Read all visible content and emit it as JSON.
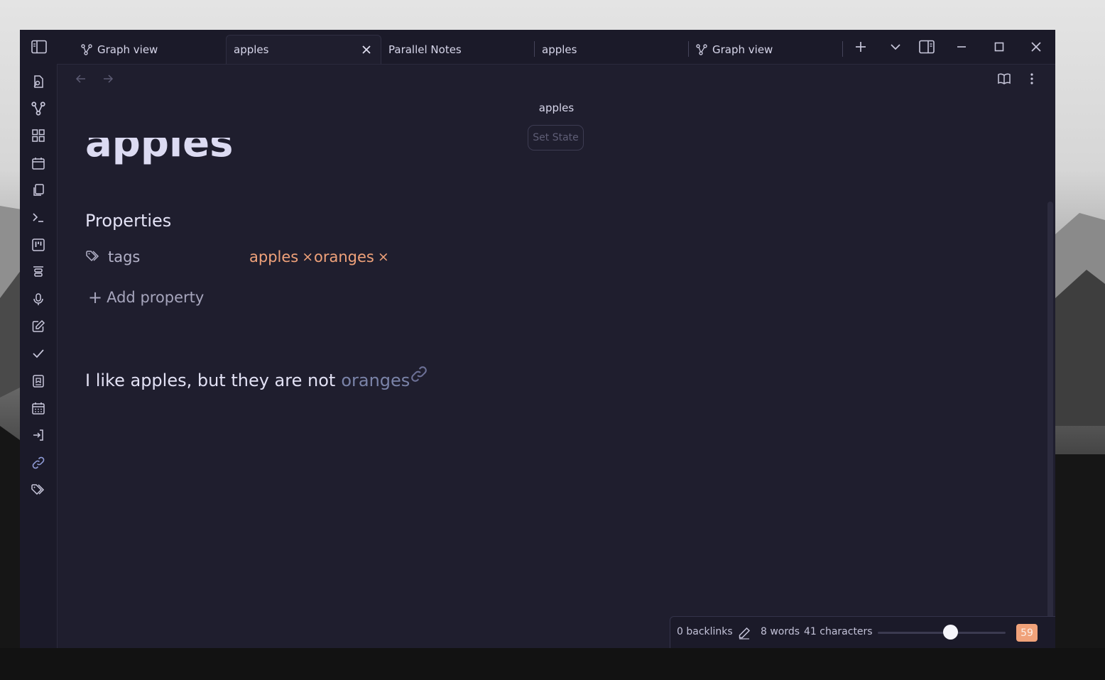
{
  "tabs": [
    {
      "label": "Graph view",
      "icon": "graph-icon",
      "active": false
    },
    {
      "label": "apples",
      "icon": null,
      "active": true
    },
    {
      "label": "Parallel Notes",
      "icon": null,
      "active": false
    },
    {
      "label": "apples",
      "icon": null,
      "active": false
    },
    {
      "label": "Graph view",
      "icon": "graph-icon",
      "active": false
    }
  ],
  "ribbon_icons": [
    "open-quick-switcher-icon",
    "graph-view-icon",
    "canvas-icon",
    "daily-note-icon",
    "templates-icon",
    "command-palette-icon",
    "kanban-icon",
    "slides-icon",
    "audio-recorder-icon",
    "new-note-icon",
    "tasks-icon",
    "bookmark-icon",
    "calendar-icon",
    "import-icon",
    "link-icon",
    "tags-icon"
  ],
  "view": {
    "title": "apples",
    "set_state_label": "Set State",
    "doc_title": "apples"
  },
  "properties": {
    "heading": "Properties",
    "key": "tags",
    "tags": [
      "apples",
      "oranges"
    ],
    "remove_symbol": "×",
    "add_label": "Add property",
    "add_symbol": "+"
  },
  "body": {
    "text": "I like apples, but they are not",
    "link_text": "oranges"
  },
  "status": {
    "backlinks": "0 backlinks",
    "words": "8 words",
    "characters": "41 characters",
    "slider_level": 0.57,
    "badge": "59"
  },
  "colors": {
    "background": "#1f1e2e",
    "accent_tag": "#f0a27a",
    "link": "#7a83a8",
    "badge": "#f0a27a"
  }
}
